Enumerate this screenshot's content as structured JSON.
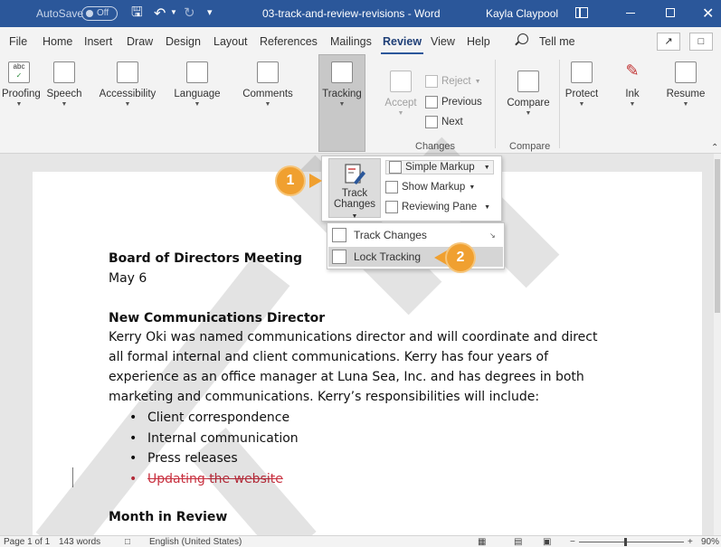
{
  "titlebar": {
    "autosave_label": "AutoSave",
    "autosave_state": "Off",
    "document_name": "03-track-and-review-revisions - Word",
    "user_name": "Kayla Claypool",
    "close_glyph": "✕"
  },
  "tabs": {
    "file": "File",
    "home": "Home",
    "insert": "Insert",
    "draw": "Draw",
    "design": "Design",
    "layout": "Layout",
    "references": "References",
    "mailings": "Mailings",
    "review": "Review",
    "view": "View",
    "help": "Help",
    "tell_me": "Tell me",
    "active": "Review"
  },
  "ribbon": {
    "proofing": "Proofing",
    "speech": "Speech",
    "accessibility": "Accessibility",
    "language": "Language",
    "comments": "Comments",
    "tracking": "Tracking",
    "accept": "Accept",
    "reject": "Reject",
    "previous": "Previous",
    "next": "Next",
    "changes_group": "Changes",
    "compare": "Compare",
    "compare_group": "Compare",
    "protect": "Protect",
    "ink": "Ink",
    "resume": "Resume"
  },
  "tracking_dropdown": {
    "track_changes_line1": "Track",
    "track_changes_line2": "Changes",
    "markup_value": "Simple Markup",
    "show_markup": "Show Markup",
    "reviewing_pane": "Reviewing Pane"
  },
  "track_changes_menu": {
    "items": [
      {
        "label": "Track Changes"
      },
      {
        "label": "Lock Tracking"
      }
    ]
  },
  "callouts": {
    "step1": "1",
    "step2": "2"
  },
  "document": {
    "heading1": "Board of Directors Meeting",
    "date": "May 6",
    "heading2": "New Communications Director",
    "paragraph": "Kerry Oki was named communications director and will coordinate and direct all formal internal and client communications. Kerry has four years of experience as an office manager at Luna Sea, Inc. and has degrees in both marketing and communications. Kerry’s responsibilities will include:",
    "bullets": [
      {
        "text": "Client correspondence",
        "deleted": false
      },
      {
        "text": "Internal communication",
        "deleted": false
      },
      {
        "text": "Press releases",
        "deleted": false
      },
      {
        "text": "Updating the website",
        "deleted": true
      }
    ],
    "heading3": "Month in Review"
  },
  "statusbar": {
    "page": "Page 1 of 1",
    "words": "143 words",
    "language": "English (United States)",
    "zoom": "90%"
  },
  "colors": {
    "titlebar": "#2b579a",
    "callout": "#f0a030",
    "deleted_text": "#c8303f"
  }
}
